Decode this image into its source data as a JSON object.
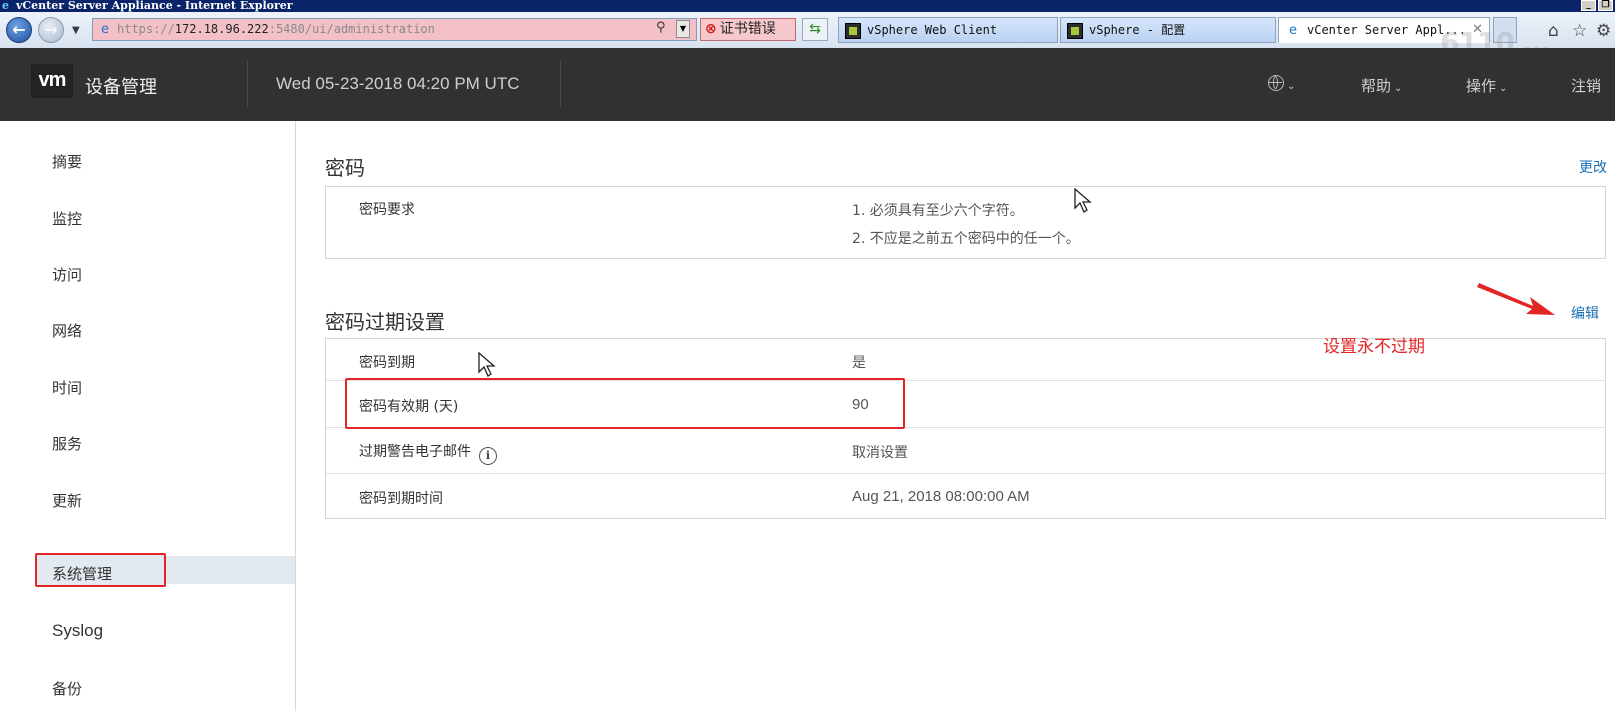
{
  "window": {
    "title": "vCenter Server Appliance - Internet Explorer"
  },
  "browser": {
    "address": {
      "scheme": "https://",
      "host": "172.18.96.222",
      "rest": ":5480/ui/administration"
    },
    "cert_error_label": "证书错误",
    "tabs": [
      {
        "label": "vSphere Web Client"
      },
      {
        "label": "vSphere - 配置"
      },
      {
        "label": "vCenter Server Appl..."
      }
    ],
    "watermark": "6110 …"
  },
  "header": {
    "logo": "vm",
    "app_title": "设备管理",
    "datetime": "Wed 05-23-2018 04:20 PM UTC",
    "menu": {
      "help": "帮助",
      "actions": "操作",
      "logout": "注销"
    }
  },
  "sidebar": {
    "items": [
      {
        "label": "摘要"
      },
      {
        "label": "监控"
      },
      {
        "label": "访问"
      },
      {
        "label": "网络"
      },
      {
        "label": "时间"
      },
      {
        "label": "服务"
      },
      {
        "label": "更新"
      },
      {
        "label": "系统管理"
      },
      {
        "label": "Syslog"
      },
      {
        "label": "备份"
      }
    ],
    "active_index": 7
  },
  "password_section": {
    "title": "密码",
    "action": "更改",
    "requirements_label": "密码要求",
    "requirements": [
      "1. 必须具有至少六个字符。",
      "2. 不应是之前五个密码中的任一个。"
    ]
  },
  "expiration_section": {
    "title": "密码过期设置",
    "action": "编辑",
    "rows": [
      {
        "label": "密码到期",
        "value": "是"
      },
      {
        "label": "密码有效期 (天)",
        "value": "90"
      },
      {
        "label": "过期警告电子邮件",
        "value": "取消设置"
      },
      {
        "label": "密码到期时间",
        "value": "Aug 21, 2018 08:00:00 AM"
      }
    ]
  },
  "annotation": {
    "text": "设置永不过期",
    "color": "#e32525"
  },
  "colors": {
    "header_bg": "#313131",
    "link": "#1a6fb5",
    "annotation_red": "#e32525"
  }
}
